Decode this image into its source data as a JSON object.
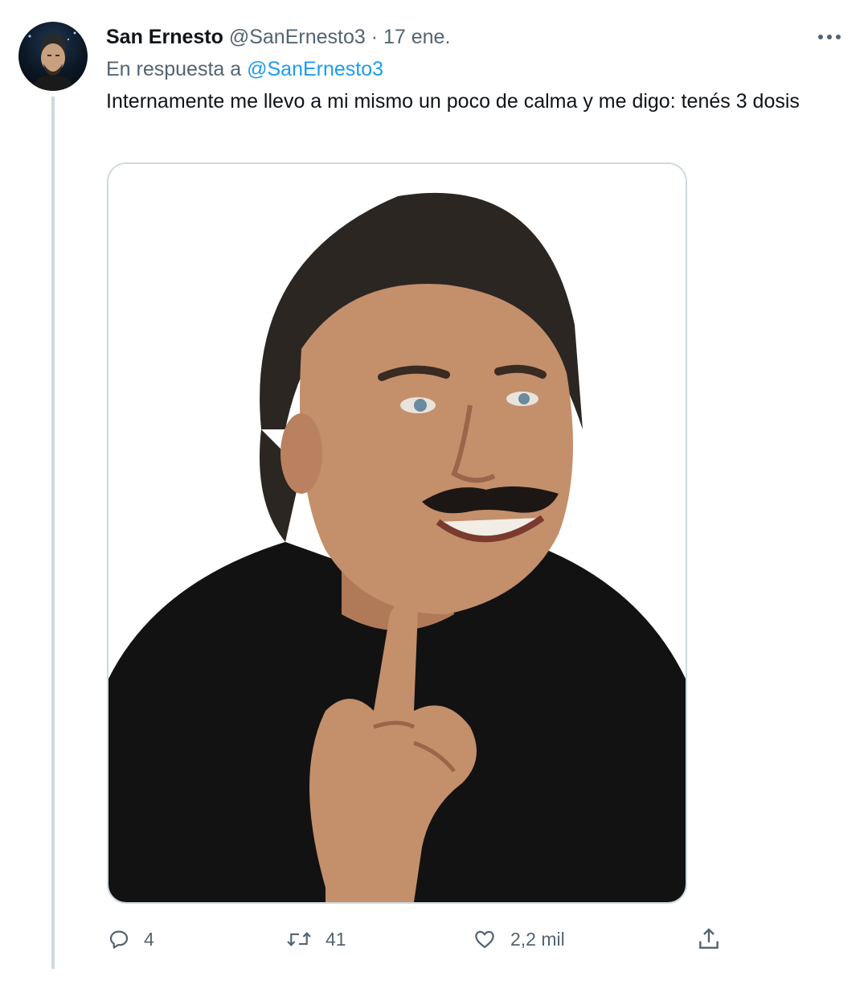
{
  "tweet": {
    "display_name": "San Ernesto",
    "handle": "@SanErnesto3",
    "separator": "·",
    "date": "17 ene.",
    "reply_prefix": "En respuesta a",
    "reply_to": "@SanErnesto3",
    "text": "Internamente me llevo a mi mismo un poco de calma y me digo: tenés 3 dosis",
    "icons": {
      "more": "more-horizontal-icon",
      "reply": "speech-bubble-icon",
      "retweet": "retweet-arrows-icon",
      "like": "heart-icon",
      "share": "share-upload-icon"
    }
  },
  "actions": {
    "replies": "4",
    "retweets": "41",
    "likes": "2,2 mil"
  },
  "colors": {
    "text": "#0f1419",
    "secondary": "#536471",
    "link": "#1d9bf0",
    "border": "#cfd9de"
  }
}
